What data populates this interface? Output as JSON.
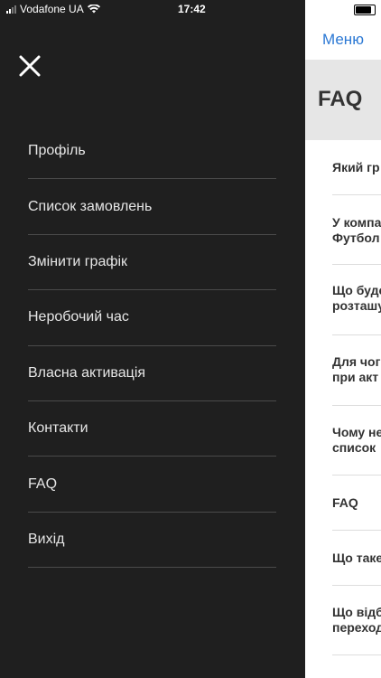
{
  "status_bar": {
    "carrier": "Vodafone UA",
    "time": "17:42"
  },
  "drawer": {
    "menu_items": [
      {
        "label": "Профіль"
      },
      {
        "label": "Список замовлень"
      },
      {
        "label": "Змінити графік"
      },
      {
        "label": "Неробочий час"
      },
      {
        "label": "Власна активація"
      },
      {
        "label": "Контакти"
      },
      {
        "label": "FAQ"
      },
      {
        "label": "Вихід"
      }
    ]
  },
  "content": {
    "back_label": "Меню",
    "title": "FAQ",
    "faq_items": [
      "Який гр",
      "У компа\nФутбол",
      "Що буде\nрозташу",
      "Для чог\nпри акт",
      "Чому не\nсписок",
      "FAQ",
      "Що таке",
      "Що відб\nпереход"
    ]
  },
  "colors": {
    "drawer_bg": "#1f1f1f",
    "accent": "#2b78d4",
    "header_bg": "#e6e6e6"
  }
}
